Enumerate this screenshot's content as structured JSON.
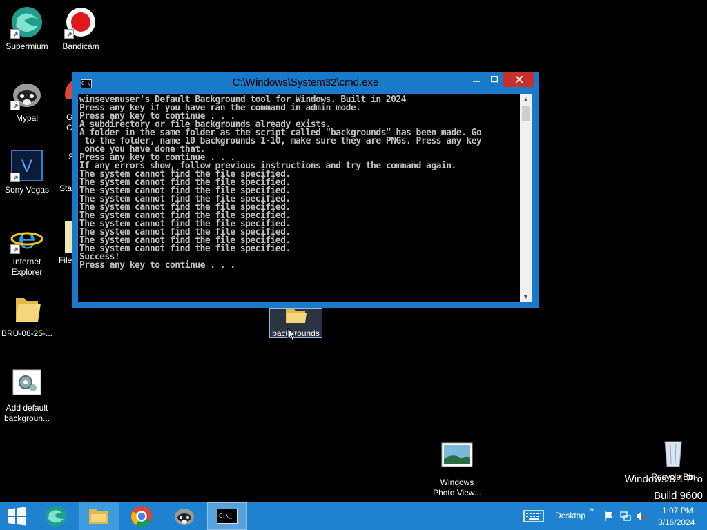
{
  "desktop": {
    "icons": [
      {
        "label": "Supermium"
      },
      {
        "label": "Bandicam"
      },
      {
        "label": "Mypal"
      },
      {
        "label": "Sony Vegas"
      },
      {
        "label": "Internet Explorer"
      },
      {
        "label": "BRU-08-25-..."
      },
      {
        "label": "Add default backgroun..."
      },
      {
        "label": "Windows Photo View..."
      },
      {
        "label": "Recycle Bin"
      },
      {
        "label": "backgrounds"
      }
    ],
    "partial_labels": [
      "G",
      "C",
      "S",
      "Star",
      "File"
    ],
    "watermark_line1": "Windows 8.1 Pro",
    "watermark_line2": "Build 9600"
  },
  "cmd_window": {
    "title": "C:\\Windows\\System32\\cmd.exe",
    "icon_text": "C:\\_",
    "output": "winsevenuser's Default Background tool for Windows. Built in 2024\nPress any key if you have ran the command in admin mode.\nPress any key to continue . . .\nA subdirectory or file backgrounds already exists.\nA folder in the same folder as the script called \"backgrounds\" has been made. Go\n to the folder, name 10 backgrounds 1-10, make sure they are PNGs. Press any key\n once you have done that.\nPress any key to continue . . .\nIf any errors show, follow previous instructions and try the command again.\nThe system cannot find the file specified.\nThe system cannot find the file specified.\nThe system cannot find the file specified.\nThe system cannot find the file specified.\nThe system cannot find the file specified.\nThe system cannot find the file specified.\nThe system cannot find the file specified.\nThe system cannot find the file specified.\nThe system cannot find the file specified.\nThe system cannot find the file specified.\nSuccess!\nPress any key to continue . . ."
  },
  "taskbar": {
    "desktop_label": "Desktop",
    "time": "1:07 PM",
    "date": "3/16/2024",
    "expand_symbol": "»"
  }
}
